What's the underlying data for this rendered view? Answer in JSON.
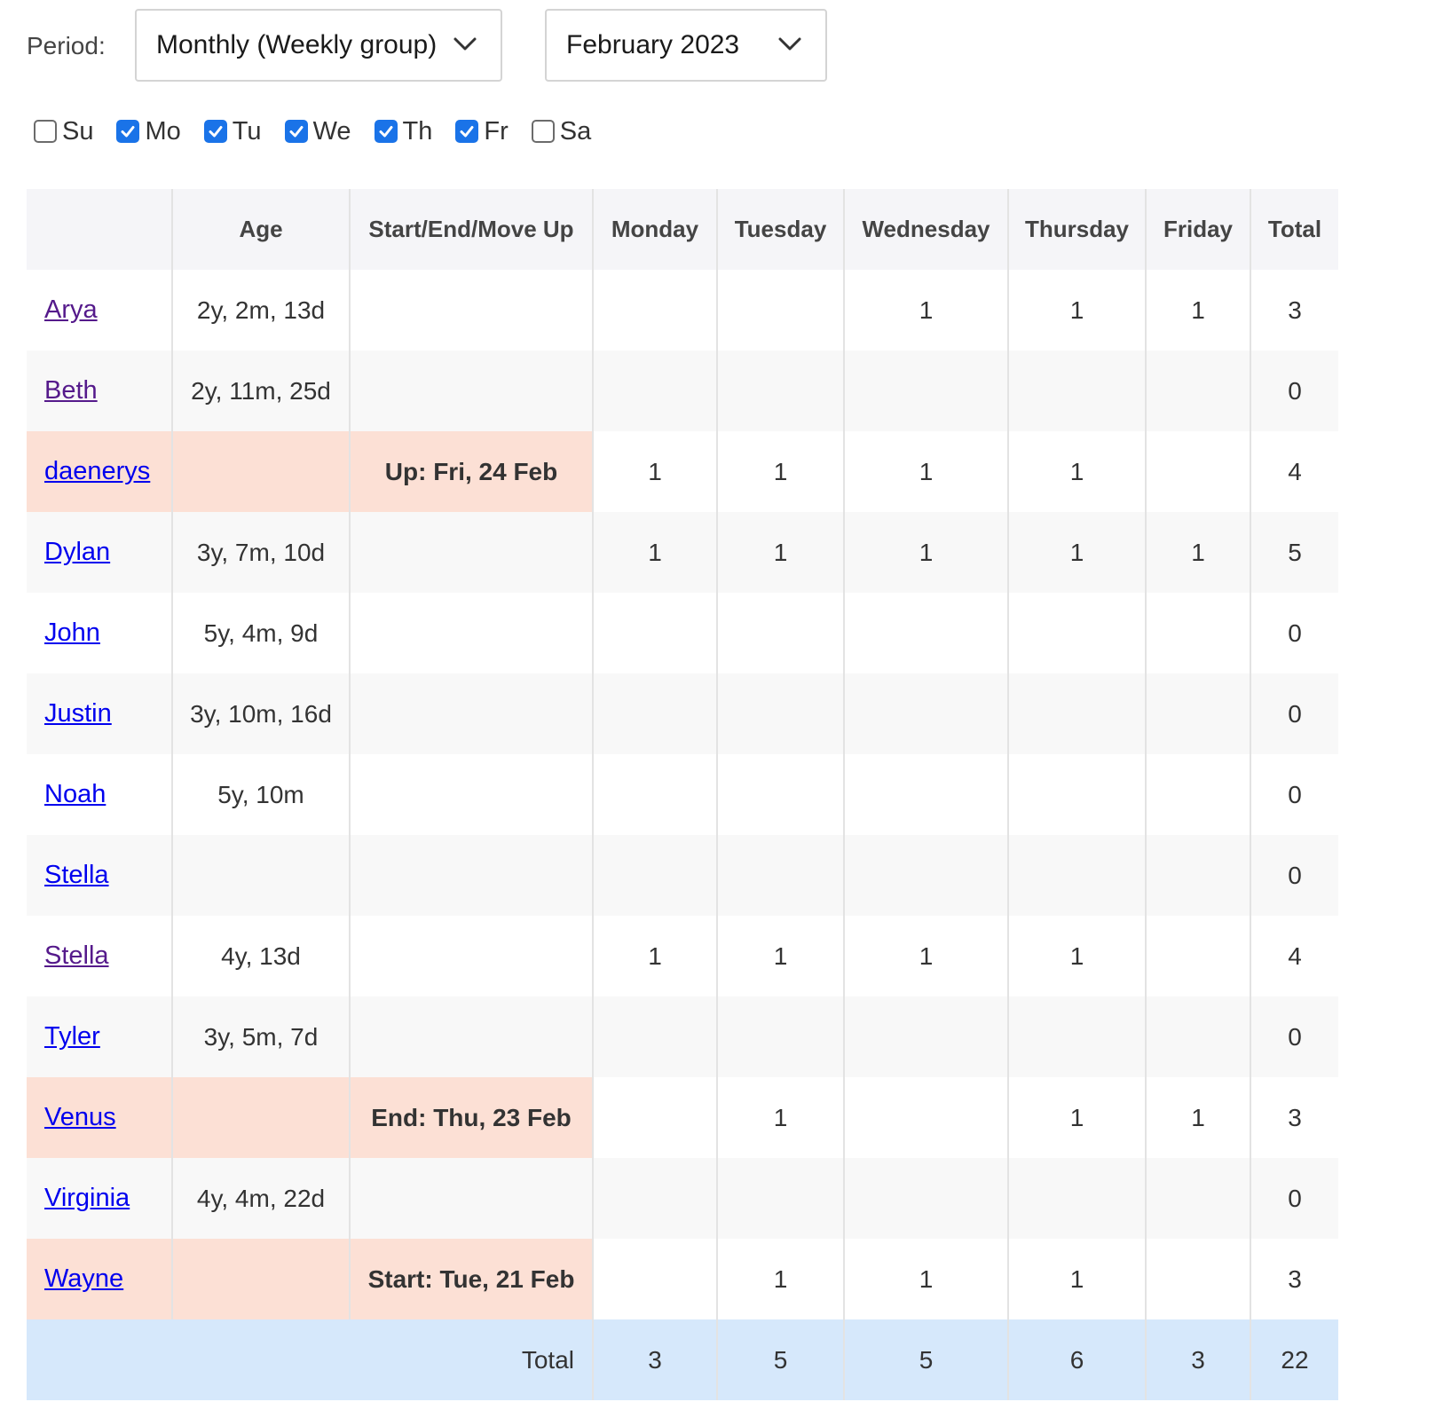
{
  "period": {
    "label": "Period:",
    "selected": "Monthly (Weekly group)",
    "month": "February 2023"
  },
  "days": [
    {
      "label": "Su",
      "checked": false
    },
    {
      "label": "Mo",
      "checked": true
    },
    {
      "label": "Tu",
      "checked": true
    },
    {
      "label": "We",
      "checked": true
    },
    {
      "label": "Th",
      "checked": true
    },
    {
      "label": "Fr",
      "checked": true
    },
    {
      "label": "Sa",
      "checked": false
    }
  ],
  "table": {
    "headers": [
      "",
      "Age",
      "Start/End/Move Up",
      "Monday",
      "Tuesday",
      "Wednesday",
      "Thursday",
      "Friday",
      "Total"
    ],
    "rows": [
      {
        "name": "Arya",
        "visited": true,
        "age": "2y, 2m, 13d",
        "event": "",
        "highlight": false,
        "mon": "",
        "tue": "",
        "wed": "1",
        "thu": "1",
        "fri": "1",
        "total": "3"
      },
      {
        "name": "Beth",
        "visited": true,
        "age": "2y, 11m, 25d",
        "event": "",
        "highlight": false,
        "mon": "",
        "tue": "",
        "wed": "",
        "thu": "",
        "fri": "",
        "total": "0"
      },
      {
        "name": "daenerys",
        "visited": false,
        "age": "",
        "event": "Up: Fri, 24 Feb",
        "highlight": true,
        "mon": "1",
        "tue": "1",
        "wed": "1",
        "thu": "1",
        "fri": "",
        "total": "4"
      },
      {
        "name": "Dylan",
        "visited": false,
        "age": "3y, 7m, 10d",
        "event": "",
        "highlight": false,
        "mon": "1",
        "tue": "1",
        "wed": "1",
        "thu": "1",
        "fri": "1",
        "total": "5"
      },
      {
        "name": "John",
        "visited": false,
        "age": "5y, 4m, 9d",
        "event": "",
        "highlight": false,
        "mon": "",
        "tue": "",
        "wed": "",
        "thu": "",
        "fri": "",
        "total": "0"
      },
      {
        "name": "Justin",
        "visited": false,
        "age": "3y, 10m, 16d",
        "event": "",
        "highlight": false,
        "mon": "",
        "tue": "",
        "wed": "",
        "thu": "",
        "fri": "",
        "total": "0"
      },
      {
        "name": "Noah",
        "visited": false,
        "age": "5y, 10m",
        "event": "",
        "highlight": false,
        "mon": "",
        "tue": "",
        "wed": "",
        "thu": "",
        "fri": "",
        "total": "0"
      },
      {
        "name": "Stella",
        "visited": false,
        "age": "",
        "event": "",
        "highlight": false,
        "mon": "",
        "tue": "",
        "wed": "",
        "thu": "",
        "fri": "",
        "total": "0"
      },
      {
        "name": "Stella",
        "visited": true,
        "age": "4y, 13d",
        "event": "",
        "highlight": false,
        "mon": "1",
        "tue": "1",
        "wed": "1",
        "thu": "1",
        "fri": "",
        "total": "4"
      },
      {
        "name": "Tyler",
        "visited": false,
        "age": "3y, 5m, 7d",
        "event": "",
        "highlight": false,
        "mon": "",
        "tue": "",
        "wed": "",
        "thu": "",
        "fri": "",
        "total": "0"
      },
      {
        "name": "Venus",
        "visited": false,
        "age": "",
        "event": "End: Thu, 23 Feb",
        "highlight": true,
        "mon": "",
        "tue": "1",
        "wed": "",
        "thu": "1",
        "fri": "1",
        "total": "3"
      },
      {
        "name": "Virginia",
        "visited": false,
        "age": "4y, 4m, 22d",
        "event": "",
        "highlight": false,
        "mon": "",
        "tue": "",
        "wed": "",
        "thu": "",
        "fri": "",
        "total": "0"
      },
      {
        "name": "Wayne",
        "visited": false,
        "age": "",
        "event": "Start: Tue, 21 Feb",
        "highlight": true,
        "mon": "",
        "tue": "1",
        "wed": "1",
        "thu": "1",
        "fri": "",
        "total": "3"
      }
    ],
    "footer": {
      "label": "Total",
      "mon": "3",
      "tue": "5",
      "wed": "5",
      "thu": "6",
      "fri": "3",
      "total": "22"
    }
  },
  "colors": {
    "highlight_row": "#fce0d5",
    "footer_bg": "#d6e8fb",
    "header_bg": "#f5f5f8",
    "link": "#0000ee",
    "visited_link": "#551a8b",
    "checkbox_accent": "#1a73e8"
  }
}
